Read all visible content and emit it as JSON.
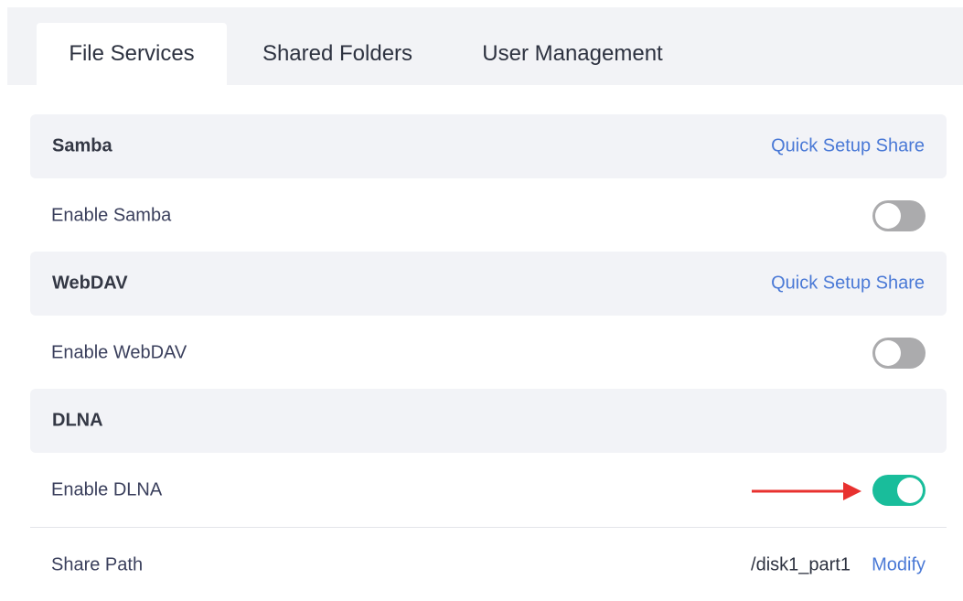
{
  "tabs": {
    "file_services": "File Services",
    "shared_folders": "Shared Folders",
    "user_management": "User Management",
    "active": "File Services"
  },
  "samba": {
    "title": "Samba",
    "link": "Quick Setup Share",
    "toggle_label": "Enable Samba",
    "enabled": false
  },
  "webdav": {
    "title": "WebDAV",
    "link": "Quick Setup Share",
    "toggle_label": "Enable WebDAV",
    "enabled": false
  },
  "dlna": {
    "title": "DLNA",
    "toggle_label": "Enable DLNA",
    "enabled": true,
    "share_path_label": "Share Path",
    "share_path_value": "/disk1_part1",
    "modify_label": "Modify"
  },
  "colors": {
    "accent_link": "#4a79d6",
    "toggle_on": "#19bd9b",
    "toggle_off": "#ababad",
    "annotation_arrow": "#e8312f"
  },
  "icons": {
    "annotation": "red-arrow-right-icon"
  }
}
